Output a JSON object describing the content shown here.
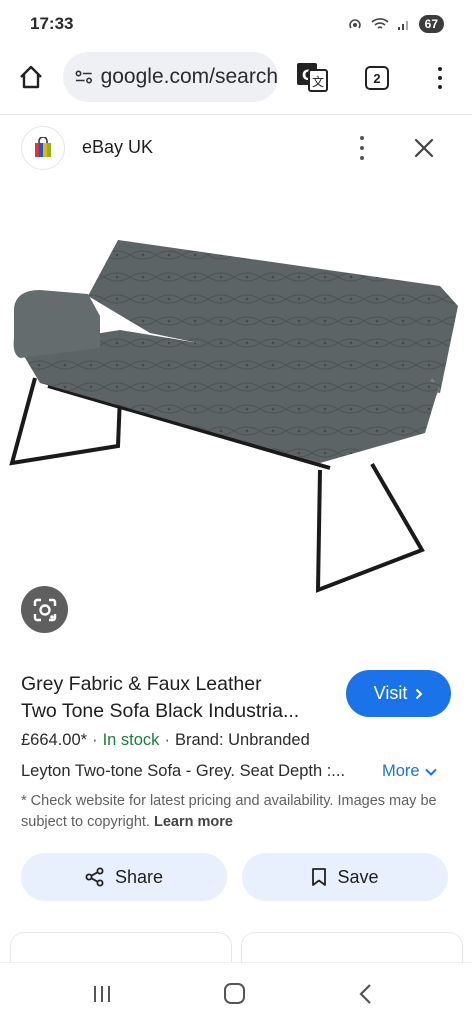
{
  "status_bar": {
    "time": "17:33",
    "battery": "67"
  },
  "browser": {
    "url": "google.com/search",
    "tab_count": "2"
  },
  "sheet": {
    "site_name": "eBay UK"
  },
  "product": {
    "title_line1": "Grey Fabric & Faux Leather",
    "title_line2": "Two Tone Sofa Black Industria...",
    "price": "£664.00*",
    "stock": "In stock",
    "brand": "Brand: Unbranded",
    "description": "Leyton Two-tone Sofa - Grey. Seat Depth :...",
    "more_label": "More",
    "visit_label": "Visit",
    "disclaimer": "* Check website for latest pricing and availability. Images may be subject to copyright.",
    "learn_more": "Learn more"
  },
  "actions": {
    "share_label": "Share",
    "save_label": "Save"
  },
  "colors": {
    "accent": "#1a73e8",
    "stock_green": "#188038",
    "button_tint": "#e8f0fe"
  }
}
